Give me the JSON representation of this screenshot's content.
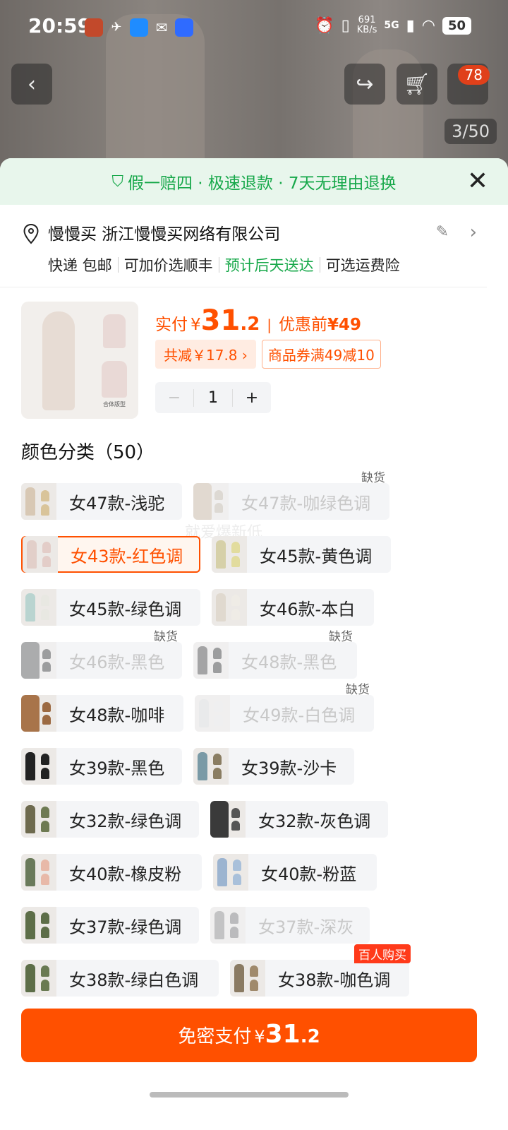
{
  "status_bar": {
    "time": "20:59",
    "net_speed": "691",
    "net_unit": "KB/s",
    "signal_label": "5G",
    "battery": "50",
    "app_icon_colors": [
      "#c2492b",
      "#ffffff",
      "#1f8cff",
      "#ffffff",
      "#2f6bff"
    ]
  },
  "hero": {
    "back_icon": "chevron-left-icon",
    "share_icon": "share-icon",
    "cart_icon": "cart-icon",
    "cart_badge": "78",
    "image_counter": "3/50"
  },
  "guarantee": {
    "text": "假一赔四 · 极速退款 · 7天无理由退换",
    "close_icon": "close-icon"
  },
  "address": {
    "name": "慢慢买 浙江慢慢买网络有限公司",
    "ship_items": [
      "快递 包邮",
      "可加价选顺丰",
      "预计后天送达",
      "可选运费险"
    ]
  },
  "product": {
    "thumb_tag": "合体版型",
    "price_label": "实付",
    "currency": "¥",
    "price_int": "31",
    "price_dec": ".2",
    "orig_label": "优惠前",
    "orig_price": "¥49",
    "discount_chip": "共减￥17.8 ›",
    "coupon_chip": "商品券满49减10",
    "quantity": "1",
    "minus": "−",
    "plus": "+"
  },
  "variants_title": "颜色分类（50）",
  "watermark": "就爱爆新低",
  "variants": [
    {
      "label": "女47款-浅驼",
      "status": "available",
      "tag": ""
    },
    {
      "label": "女47款-咖绿色调",
      "status": "out_of_stock",
      "tag": "缺货"
    },
    {
      "label": "女43款-红色调",
      "status": "selected",
      "tag": ""
    },
    {
      "label": "女45款-黄色调",
      "status": "available",
      "tag": ""
    },
    {
      "label": "女45款-绿色调",
      "status": "available",
      "tag": ""
    },
    {
      "label": "女46款-本白",
      "status": "available",
      "tag": ""
    },
    {
      "label": "女46款-黑色",
      "status": "out_of_stock",
      "tag": "缺货"
    },
    {
      "label": "女48款-黑色",
      "status": "out_of_stock",
      "tag": "缺货"
    },
    {
      "label": "女48款-咖啡",
      "status": "available",
      "tag": ""
    },
    {
      "label": "女49款-白色调",
      "status": "out_of_stock",
      "tag": "缺货"
    },
    {
      "label": "女39款-黑色",
      "status": "available",
      "tag": ""
    },
    {
      "label": "女39款-沙卡",
      "status": "available",
      "tag": ""
    },
    {
      "label": "女32款-绿色调",
      "status": "available",
      "tag": ""
    },
    {
      "label": "女32款-灰色调",
      "status": "available",
      "tag": ""
    },
    {
      "label": "女40款-橡皮粉",
      "status": "available",
      "tag": ""
    },
    {
      "label": "女40款-粉蓝",
      "status": "available",
      "tag": ""
    },
    {
      "label": "女37款-绿色调",
      "status": "available",
      "tag": ""
    },
    {
      "label": "女37款-深灰",
      "status": "unavailable",
      "tag": ""
    },
    {
      "label": "女38款-绿白色调",
      "status": "available",
      "tag": ""
    },
    {
      "label": "女38款-咖色调",
      "status": "available",
      "tag": "百人购买"
    }
  ],
  "pay_button": {
    "label": "免密支付",
    "currency": "¥",
    "price_int": "31",
    "price_dec": ".2"
  },
  "colors": {
    "accent": "#ff5000",
    "guarantee_green": "#17a84a"
  }
}
